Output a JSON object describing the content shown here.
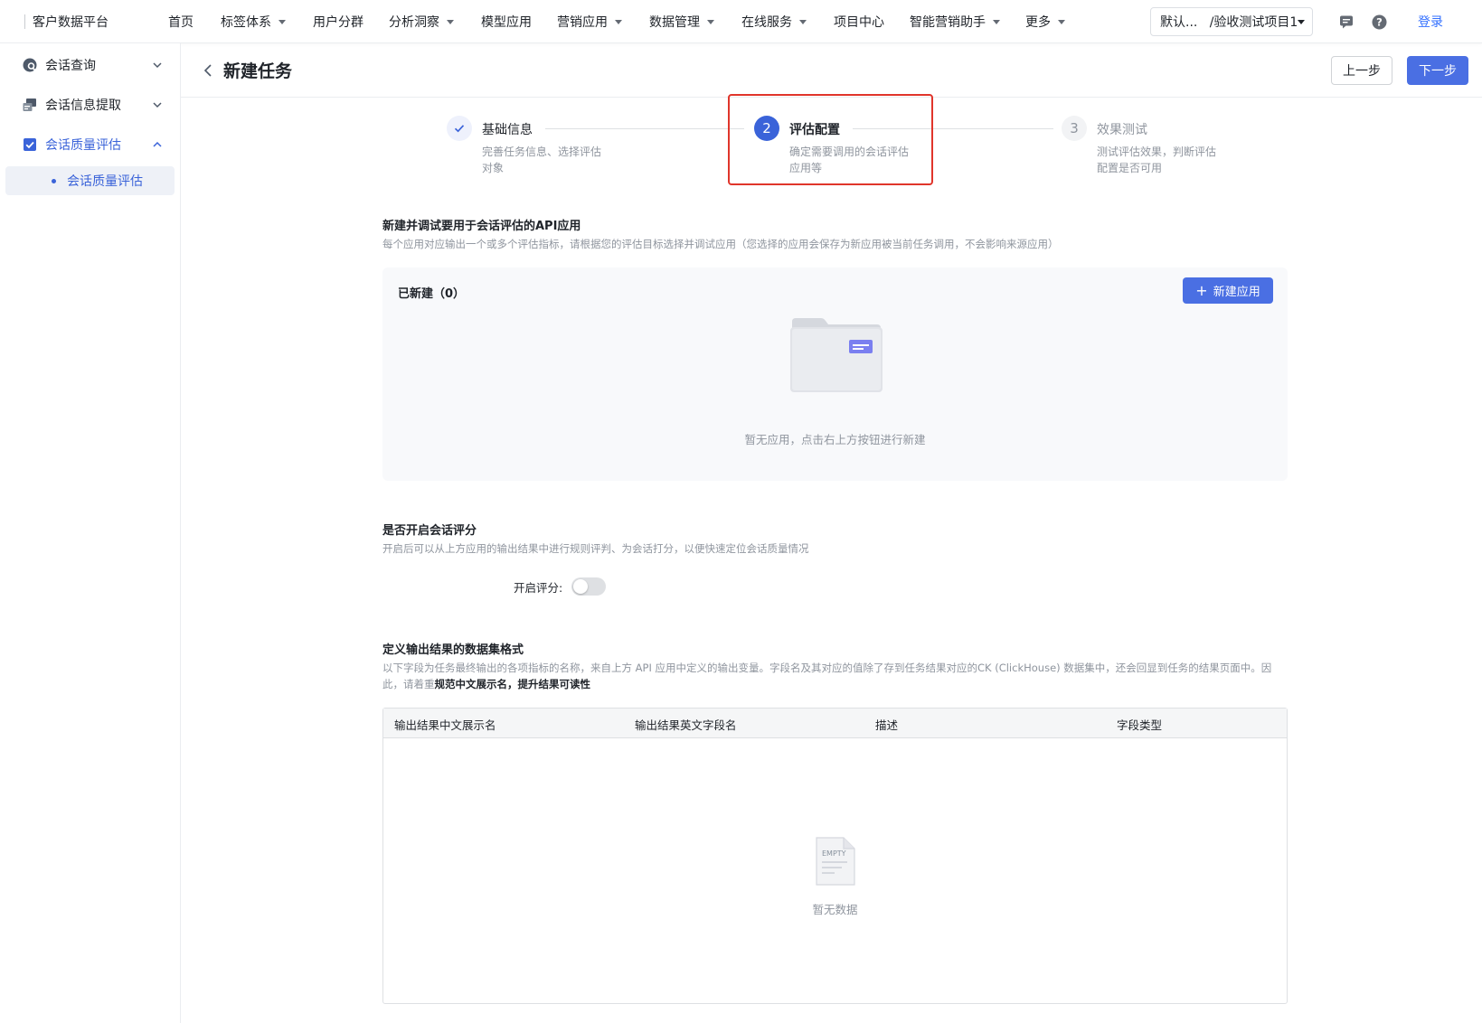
{
  "app": {
    "brand": "客户数据平台"
  },
  "topnav": {
    "items": [
      {
        "label": "首页",
        "dropdown": false
      },
      {
        "label": "标签体系",
        "dropdown": true
      },
      {
        "label": "用户分群",
        "dropdown": false
      },
      {
        "label": "分析洞察",
        "dropdown": true
      },
      {
        "label": "模型应用",
        "dropdown": false
      },
      {
        "label": "营销应用",
        "dropdown": true
      },
      {
        "label": "数据管理",
        "dropdown": true
      },
      {
        "label": "在线服务",
        "dropdown": true
      },
      {
        "label": "项目中心",
        "dropdown": false
      },
      {
        "label": "智能营销助手",
        "dropdown": true
      },
      {
        "label": "更多",
        "dropdown": true
      }
    ],
    "project": "默认...   /验收测试项目1",
    "login": "登录",
    "icons": [
      "message-icon",
      "help-icon"
    ]
  },
  "sidebar": {
    "items": [
      {
        "label": "会话查询",
        "icon": "chat-search-icon",
        "expanded": false
      },
      {
        "label": "会话信息提取",
        "icon": "extract-icon",
        "expanded": false
      },
      {
        "label": "会话质量评估",
        "icon": "checkbox-icon",
        "expanded": true
      }
    ],
    "sub_item": "会话质量评估"
  },
  "header": {
    "title": "新建任务",
    "prev": "上一步",
    "next": "下一步"
  },
  "steps": [
    {
      "index": "1",
      "title": "基础信息",
      "desc": "完善任务信息、选择评估对象",
      "status": "done"
    },
    {
      "index": "2",
      "title": "评估配置",
      "desc": "确定需要调用的会话评估应用等",
      "status": "active"
    },
    {
      "index": "3",
      "title": "效果测试",
      "desc": "测试评估效果，判断评估配置是否可用",
      "status": "pending"
    }
  ],
  "api_section": {
    "title": "新建并调试要用于会话评估的API应用",
    "desc": "每个应用对应输出一个或多个评估指标，请根据您的评估目标选择并调试应用（您选择的应用会保存为新应用被当前任务调用，不会影响来源应用）",
    "count_label": "已新建（0）",
    "new_button": "新建应用",
    "empty": "暂无应用，点击右上方按钮进行新建"
  },
  "scoring_section": {
    "title": "是否开启会话评分",
    "desc": "开启后可以从上方应用的输出结果中进行规则评判、为会话打分，以便快速定位会话质量情况",
    "toggle_label": "开启评分:",
    "enabled": false
  },
  "output_section": {
    "title": "定义输出结果的数据集格式",
    "desc_part1": "以下字段为任务最终输出的各项指标的名称，来自上方 API 应用中定义的输出变量。字段名及其对应的值除了存到任务结果对应的CK (ClickHouse) 数据集中，还会回显到任务的结果页面中。因此，请着重",
    "desc_bold": "规范中文展示名，提升结果可读性",
    "columns": [
      "输出结果中文展示名",
      "输出结果英文字段名",
      "描述",
      "字段类型"
    ],
    "empty_badge": "EMPTY",
    "empty": "暂无数据"
  },
  "colors": {
    "primary": "#4a6fe3",
    "highlight": "#e0352b",
    "sidebar_active": "#3a63d9"
  }
}
